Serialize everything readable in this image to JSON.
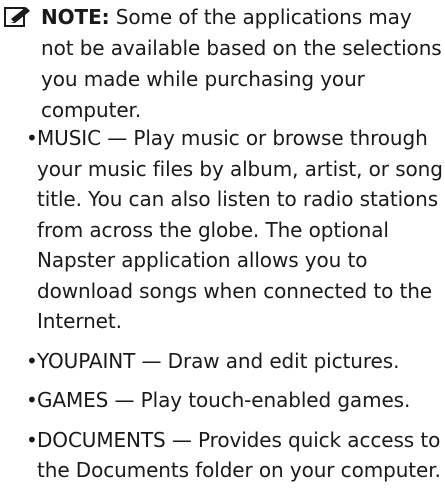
{
  "note": {
    "icon": "pencil-note-icon",
    "label": "NOTE:",
    "text": " Some of the applications may not be available based on the selections you made while purchasing your computer."
  },
  "bullets": [
    {
      "symbol": "•",
      "text": "MUSIC — Play music or browse through your music files by album, artist, or song title. You can also listen to radio stations from across the globe. The optional Napster application allows you to download songs when connected to the Internet."
    },
    {
      "symbol": "•",
      "text": "YOUPAINT — Draw and edit pictures."
    },
    {
      "symbol": "•",
      "text": "GAMES — Play touch-enabled games."
    },
    {
      "symbol": "•",
      "text": "DOCUMENTS — Provides quick access to the Documents folder on your computer."
    }
  ]
}
